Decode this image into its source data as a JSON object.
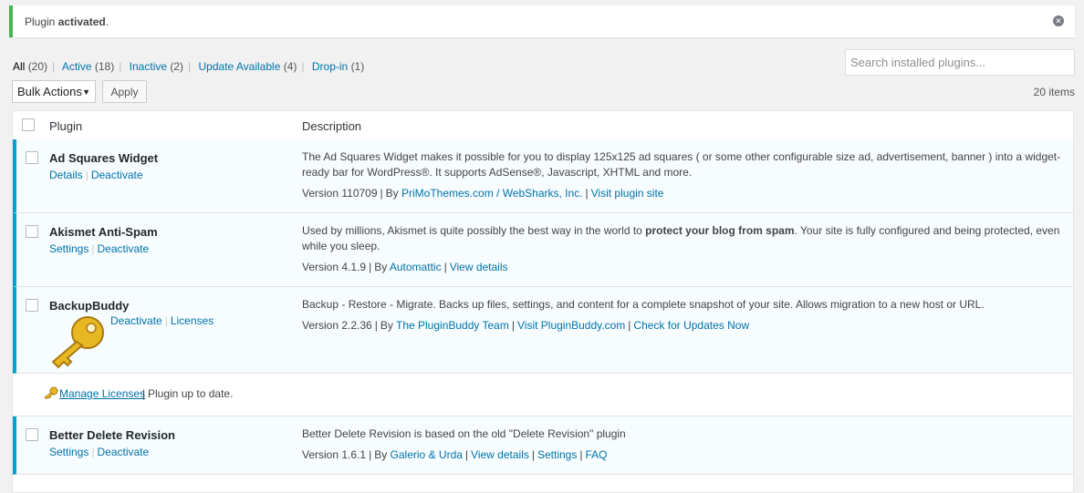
{
  "notice": {
    "prefix": "Plugin ",
    "strong": "activated",
    "suffix": ".",
    "dismiss_icon": "dismiss-icon"
  },
  "filters": [
    {
      "label": "All",
      "count": "(20)",
      "current": true
    },
    {
      "label": "Active",
      "count": "(18)"
    },
    {
      "label": "Inactive",
      "count": "(2)"
    },
    {
      "label": "Update Available",
      "count": "(4)"
    },
    {
      "label": "Drop-in",
      "count": "(1)"
    }
  ],
  "search": {
    "placeholder": "Search installed plugins..."
  },
  "bulk": {
    "selected": "Bulk Actions",
    "apply": "Apply"
  },
  "items_count": "20 items",
  "table": {
    "col_plugin": "Plugin",
    "col_description": "Description"
  },
  "plugins": [
    {
      "name": "Ad Squares Widget",
      "actions": [
        "Details",
        "Deactivate"
      ],
      "description": "The Ad Squares Widget makes it possible for you to display 125x125 ad squares ( or some other configurable size ad, advertisement, banner ) into a widget-ready bar for WordPress®. It supports AdSense®, Javascript, XHTML and more.",
      "version": "Version 110709",
      "by": "By",
      "author": "PriMoThemes.com / WebSharks, Inc.",
      "extra_links": [
        "Visit plugin site"
      ]
    },
    {
      "name": "Akismet Anti-Spam",
      "actions": [
        "Settings",
        "Deactivate"
      ],
      "description_pre": "Used by millions, Akismet is quite possibly the best way in the world to ",
      "description_strong": "protect your blog from spam",
      "description_post": ". Your site is fully configured and being protected, even while you sleep.",
      "version": "Version 4.1.9",
      "by": "By",
      "author": "Automattic",
      "extra_links": [
        "View details"
      ]
    },
    {
      "name": "BackupBuddy",
      "actions": [
        "Deactivate",
        "Licenses"
      ],
      "description": "Backup - Restore - Migrate. Backs up files, settings, and content for a complete snapshot of your site. Allows migration to a new host or URL.",
      "version": "Version 2.2.36",
      "by": "By",
      "author": "The PluginBuddy Team",
      "extra_links": [
        "Visit PluginBuddy.com",
        "Check for Updates Now"
      ],
      "manage_licenses": "Manage Licenses",
      "license_status": "Plugin up to date."
    },
    {
      "name": "Better Delete Revision",
      "actions": [
        "Settings",
        "Deactivate"
      ],
      "description": "Better Delete Revision is based on the old \"Delete Revision\" plugin",
      "version": "Version 1.6.1",
      "by": "By",
      "author": "Galerio & Urda",
      "extra_links": [
        "View details",
        "Settings",
        "FAQ"
      ]
    }
  ],
  "colors": {
    "accent": "#0073aa",
    "active_border": "#00a0d2",
    "success": "#46b450",
    "key_gold": "#e8b823"
  }
}
